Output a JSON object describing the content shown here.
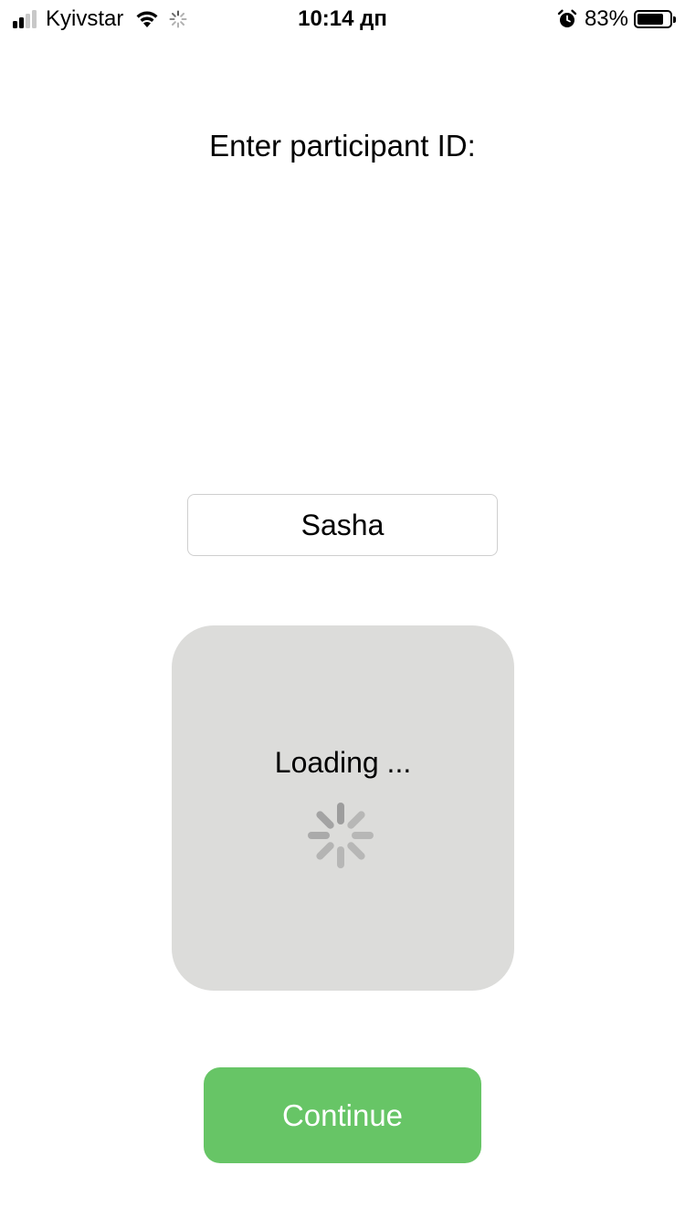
{
  "status_bar": {
    "carrier": "Kyivstar",
    "time": "10:14 дп",
    "battery_percent": "83%",
    "battery_level": 0.83,
    "signal_bars_active": 2,
    "signal_bars_total": 4,
    "icons": [
      "signal-icon",
      "wifi-icon",
      "activity-indicator-icon",
      "alarm-icon",
      "battery-icon"
    ]
  },
  "form": {
    "prompt": "Enter participant ID:",
    "participant_id_value": "Sasha"
  },
  "loading": {
    "text": "Loading ..."
  },
  "actions": {
    "continue_label": "Continue"
  },
  "colors": {
    "continue_button": "#67c566",
    "loading_overlay": "#dcdcda",
    "spinner": "#9a9a9a"
  }
}
